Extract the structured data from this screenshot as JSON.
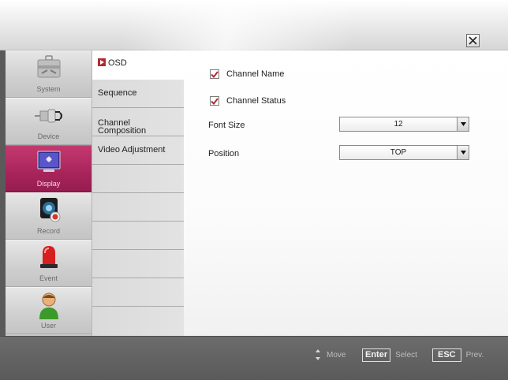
{
  "header": {
    "close_icon": "close-icon"
  },
  "sidebar": {
    "items": [
      {
        "label": "System",
        "icon": "toolbox-icon"
      },
      {
        "label": "Device",
        "icon": "plug-icon"
      },
      {
        "label": "Display",
        "icon": "monitor-icon",
        "active": true
      },
      {
        "label": "Record",
        "icon": "camera-record-icon"
      },
      {
        "label": "Event",
        "icon": "alarm-light-icon"
      },
      {
        "label": "User",
        "icon": "user-icon"
      }
    ]
  },
  "submenu": {
    "items": [
      {
        "label": "OSD",
        "active": true
      },
      {
        "label": "Sequence"
      },
      {
        "label": "Channel\nComposition"
      },
      {
        "label": "Video Adjustment"
      }
    ]
  },
  "osd": {
    "channel_name": {
      "label": "Channel Name",
      "checked": true
    },
    "channel_status": {
      "label": "Channel Status",
      "checked": true
    },
    "font_size": {
      "label": "Font Size",
      "value": "12"
    },
    "position": {
      "label": "Position",
      "value": "TOP"
    }
  },
  "footer": {
    "move_label": "Move",
    "enter_key": "Enter",
    "select_label": "Select",
    "esc_key": "ESC",
    "prev_label": "Prev."
  },
  "colors": {
    "accent": "#a8245a",
    "check": "#b22a2e"
  }
}
